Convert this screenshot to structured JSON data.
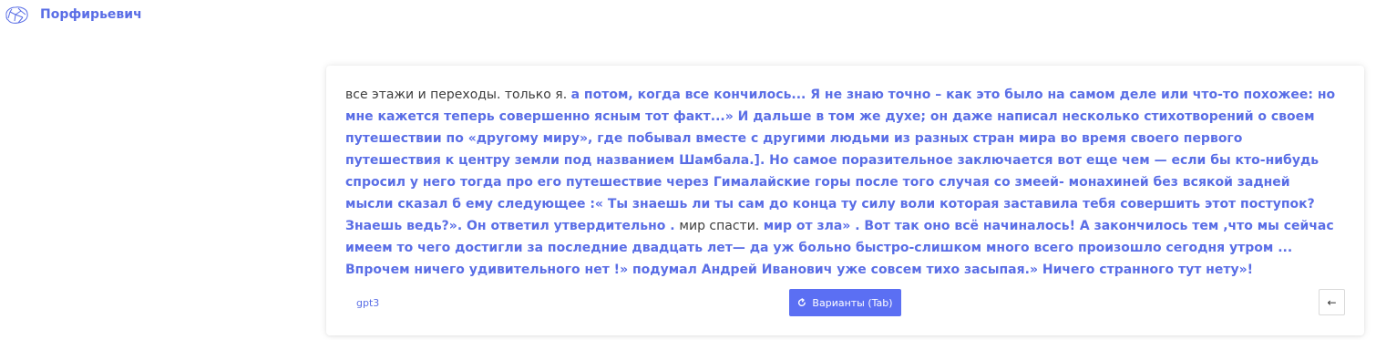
{
  "app": {
    "logo_icon": "brain-icon",
    "brand_name": "Порфирьевич",
    "accent_color": "#5a6ee6"
  },
  "editor": {
    "segments": [
      {
        "kind": "prompt",
        "text": "все этажи и переходы. только я. "
      },
      {
        "kind": "generated",
        "text": "а потом, когда все кончилось... Я не знаю точно – как это было на самом деле или что-то похожее: но мне кажется теперь совершенно ясным тот факт...» И дальше в том же духе; он даже написал несколько стихотворений о своем путешествии по «другому миру», где побывал вместе с другими людьми из разных стран мира во время своего первого путешествия к центру земли под названием Шамбала.]. Но самое поразительное заключается вот еще чем — если бы кто-нибудь спросил у него тогда про его путешествие через Гималайские горы после того случая со змеей- монахиней без всякой задней мысли сказал б ему следующее :« Ты знаешь ли ты сам до конца ту силу воли которая заставила тебя совершить этот поступок? Знаешь ведь?». Он ответил утвердительно . "
      },
      {
        "kind": "prompt",
        "text": "мир спасти. "
      },
      {
        "kind": "generated",
        "text": "мир от зла» . Вот так оно всё начиналось! А закончилось тем ,что мы сейчас имеем то чего достигли за последние двадцать лет— да уж больно быстро-слишком много всего произошло сегодня утром ... Впрочем ничего удивительного нет !» подумал Андрей Иванович уже совсем тихо засыпая.» Ничего странного тут нету»!"
      }
    ]
  },
  "footer": {
    "model_label": "gpt3",
    "variants_label": "Варианты (Tab)",
    "variants_icon": "refresh-icon",
    "back_label": "←",
    "back_icon": "arrow-left-icon"
  }
}
